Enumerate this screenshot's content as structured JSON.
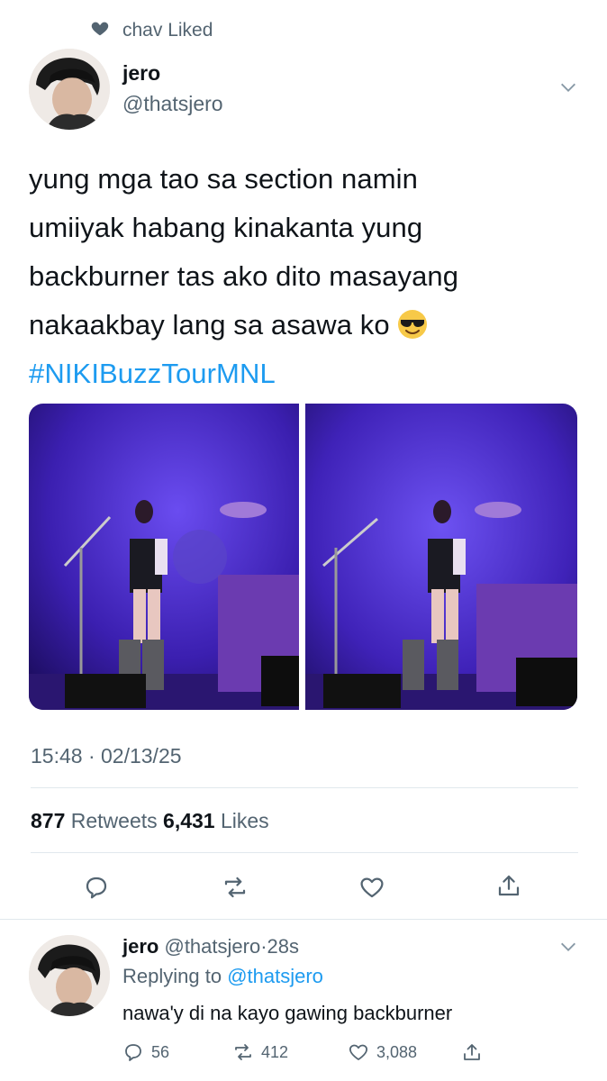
{
  "social_context": {
    "text": "chav Liked"
  },
  "tweet": {
    "author_name": "jero",
    "author_handle": "@thatsjero",
    "text_lines": [
      "yung mga tao sa section namin",
      "umiiyak habang kinakanta yung",
      "backburner tas ako dito masayang",
      "nakaakbay lang sa asawa ko"
    ],
    "emoji": "smiling-face-with-sunglasses",
    "hashtag": "#NIKIBuzzTourMNL",
    "timestamp": "15:48 · 02/13/25",
    "retweets_count": "877",
    "retweets_label": "Retweets",
    "likes_count": "6,431",
    "likes_label": "Likes"
  },
  "reply": {
    "author_name": "jero",
    "author_handle": "@thatsjero",
    "separator": "·",
    "time": "28s",
    "replying_to_label": "Replying to",
    "replying_to_handle": "@thatsjero",
    "text": "nawa'y di na kayo gawing backburner",
    "reply_count": "56",
    "retweet_count": "412",
    "like_count": "3,088"
  },
  "colors": {
    "accent": "#1d9bf0",
    "muted_text": "#536471",
    "divider": "#e1e8ed",
    "stage_purple": "#4b2bd6"
  }
}
